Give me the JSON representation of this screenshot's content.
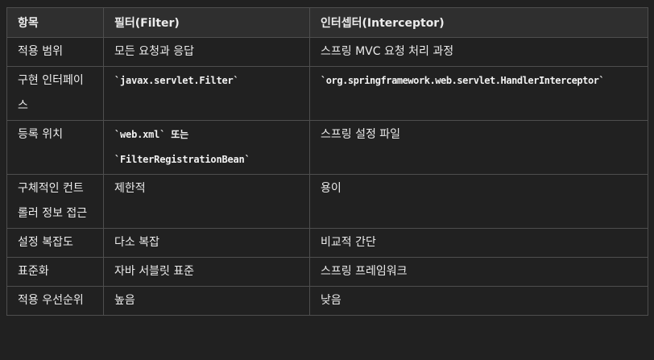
{
  "table": {
    "headers": [
      "항목",
      "필터(Filter)",
      "인터셉터(Interceptor)"
    ],
    "rows": [
      {
        "item": "적용 범위",
        "filter": "모든 요청과 응답",
        "interceptor": "스프링 MVC 요청 처리 과정"
      },
      {
        "item": "구현 인터페이스",
        "filter": "`javax.servlet.Filter`",
        "interceptor": "`org.springframework.web.servlet.HandlerInterceptor`"
      },
      {
        "item": "등록 위치",
        "filter_line1": "`web.xml` 또는",
        "filter_line2": "`FilterRegistrationBean`",
        "interceptor": "스프링 설정 파일"
      },
      {
        "item": "구체적인 컨트롤러 정보 접근",
        "filter": "제한적",
        "interceptor": "용이"
      },
      {
        "item": "설정 복잡도",
        "filter": "다소 복잡",
        "interceptor": "비교적 간단"
      },
      {
        "item": "표준화",
        "filter": "자바 서블릿 표준",
        "interceptor": "스프링 프레임워크"
      },
      {
        "item": "적용 우선순위",
        "filter": "높음",
        "interceptor": "낮음"
      }
    ]
  }
}
